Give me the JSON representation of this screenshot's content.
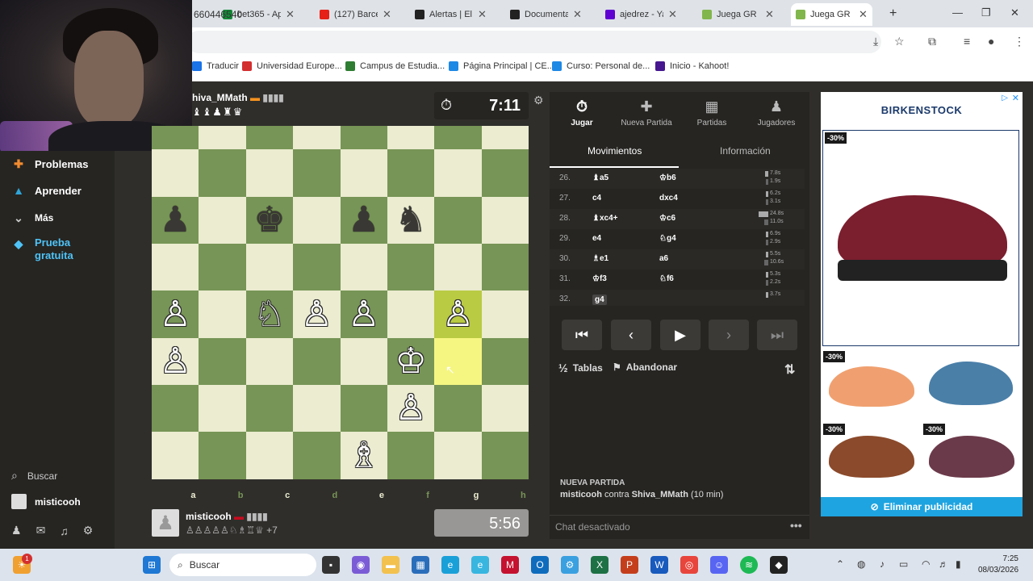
{
  "browser": {
    "tabs": [
      {
        "label": "bet365 - Apu",
        "color": "#138a36"
      },
      {
        "label": "(127) Barcelo",
        "color": "#e62117"
      },
      {
        "label": "Alertas | El m",
        "color": "#222222"
      },
      {
        "label": "Documentaci",
        "color": "#222222"
      },
      {
        "label": "ajedrez - Yah",
        "color": "#6001d2"
      },
      {
        "label": "Juega GR",
        "color": "#81b64c"
      },
      {
        "label": "Juega GR",
        "color": "#81b64c"
      }
    ],
    "url": "660446540",
    "bookmarks": [
      {
        "label": "Traducir",
        "color": "#1a73e8"
      },
      {
        "label": "Universidad Europe...",
        "color": "#d32f2f"
      },
      {
        "label": "Campus de Estudia...",
        "color": "#2e7d32"
      },
      {
        "label": "Página Principal | CE...",
        "color": "#1e88e5"
      },
      {
        "label": "Curso: Personal de...",
        "color": "#1e88e5"
      },
      {
        "label": "Inicio - Kahoot!",
        "color": "#46178f"
      }
    ]
  },
  "sitenav": {
    "items": [
      {
        "label": "Problemas",
        "icon": "puzzle-icon"
      },
      {
        "label": "Aprender",
        "icon": "graduation-cap-icon"
      },
      {
        "label": "Más",
        "icon": "chevron-down-icon"
      },
      {
        "label": "Prueba gratuita",
        "icon": "diamond-icon"
      }
    ],
    "search": "Buscar",
    "user": "misticooh"
  },
  "top_player": {
    "name": "hiva_MMath",
    "captured": "♝♝♟♜♛",
    "clock": "7:11"
  },
  "bottom_player": {
    "name": "misticooh",
    "captured": "♙♙♙♙♙♘♗♖♕",
    "advantage": "+7",
    "clock": "5:56"
  },
  "board": {
    "files": [
      "a",
      "b",
      "c",
      "d",
      "e",
      "f",
      "g",
      "h"
    ],
    "ranks": [
      "1",
      "2",
      "3",
      "4",
      "5",
      "6",
      "7"
    ],
    "pieces": [
      {
        "sq": "a6",
        "p": "♟",
        "side": "b"
      },
      {
        "sq": "c6",
        "p": "♚",
        "side": "b"
      },
      {
        "sq": "e6",
        "p": "♟",
        "side": "b"
      },
      {
        "sq": "f6",
        "p": "♞",
        "side": "b"
      },
      {
        "sq": "a4",
        "p": "♙",
        "side": "w"
      },
      {
        "sq": "c4",
        "p": "♘",
        "side": "w"
      },
      {
        "sq": "d4",
        "p": "♙",
        "side": "w"
      },
      {
        "sq": "e4",
        "p": "♙",
        "side": "w"
      },
      {
        "sq": "g4",
        "p": "♙",
        "side": "w"
      },
      {
        "sq": "a3",
        "p": "♙",
        "side": "w"
      },
      {
        "sq": "f3",
        "p": "♔",
        "side": "w"
      },
      {
        "sq": "f2",
        "p": "♙",
        "side": "w"
      },
      {
        "sq": "e1",
        "p": "♗",
        "side": "w"
      }
    ],
    "highlights": [
      "g4",
      "g3"
    ]
  },
  "panel": {
    "tabs": [
      {
        "label": "Jugar",
        "icon": "stopwatch-icon"
      },
      {
        "label": "Nueva Partida",
        "icon": "plus-icon"
      },
      {
        "label": "Partidas",
        "icon": "grid-icon"
      },
      {
        "label": "Jugadores",
        "icon": "users-icon"
      }
    ],
    "subtabs": [
      "Movimientos",
      "Información"
    ],
    "moves": [
      {
        "n": "26.",
        "w": "♝a5",
        "b": "♔b6",
        "tw": "7.8s",
        "tb": "1.9s"
      },
      {
        "n": "27.",
        "w": "c4",
        "b": "dxc4",
        "tw": "6.2s",
        "tb": "3.1s"
      },
      {
        "n": "28.",
        "w": "♝xc4+",
        "b": "♔c6",
        "tw": "24.8s",
        "tb": "11.0s"
      },
      {
        "n": "29.",
        "w": "e4",
        "b": "♘g4",
        "tw": "6.9s",
        "tb": "2.9s"
      },
      {
        "n": "30.",
        "w": "♗e1",
        "b": "a6",
        "tw": "5.5s",
        "tb": "10.6s"
      },
      {
        "n": "31.",
        "w": "♔f3",
        "b": "♘f6",
        "tw": "5.3s",
        "tb": "2.2s"
      },
      {
        "n": "32.",
        "w": "g4",
        "b": "",
        "tw": "3.7s",
        "tb": ""
      }
    ],
    "draw_label": "Tablas",
    "resign_label": "Abandonar",
    "new_game_heading": "NUEVA PARTIDA",
    "new_game_user": "misticooh",
    "new_game_vs": "contra",
    "new_game_opponent": "Shiva_MMath",
    "new_game_time": "(10 min)",
    "chat": "Chat desactivado"
  },
  "ad": {
    "brand": "BIRKENSTOCK",
    "discount": "-30%",
    "cta": "Eliminar publicidad",
    "colors": {
      "burgundy": "#7b1e2e",
      "orange": "#f0a070",
      "blue": "#4a7fa8",
      "brown": "#8b4a2b"
    }
  },
  "taskbar": {
    "search": "Buscar",
    "time": "7:25",
    "date": "08/03/2026",
    "notification_count": "1"
  }
}
